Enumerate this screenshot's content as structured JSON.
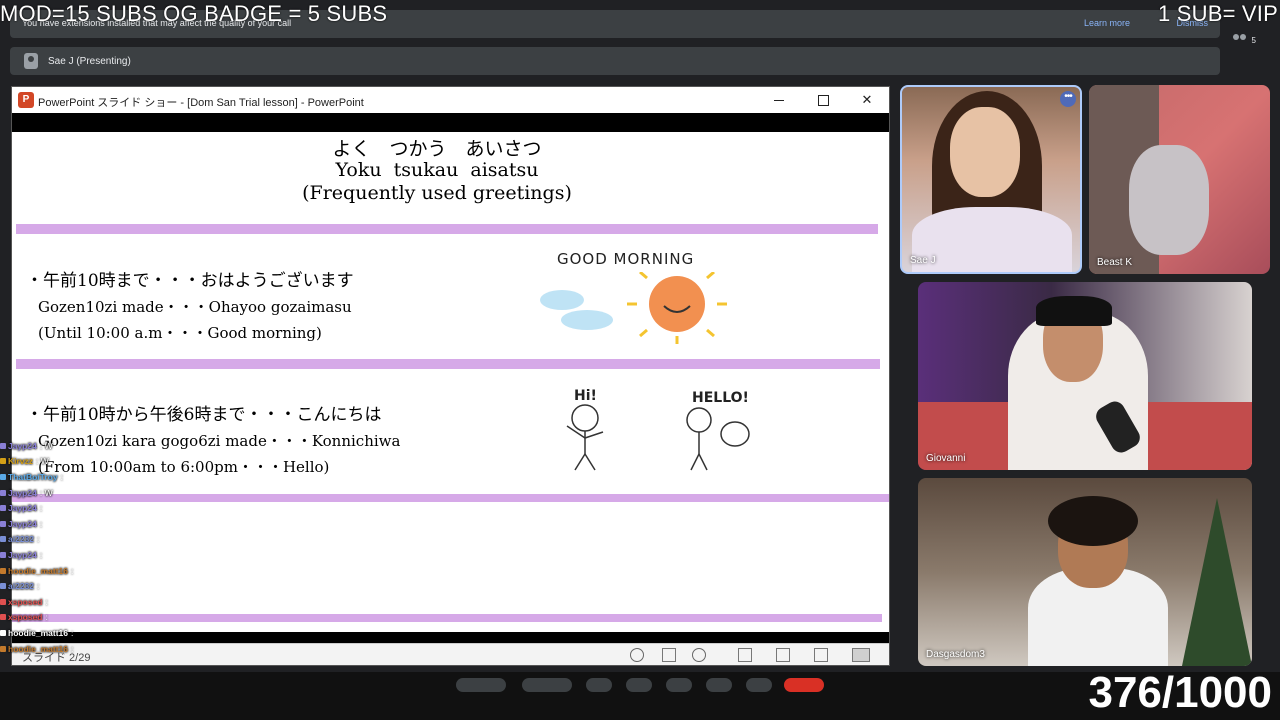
{
  "overlay": {
    "top_left": "MOD=15 SUBS    OG BADGE = 5 SUBS",
    "top_right": "1 SUB= VIP",
    "counter": "376/1000"
  },
  "meet": {
    "warning_banner": {
      "message": "You have extensions installed that may affect the quality of your call",
      "learn_more": "Learn more",
      "dismiss": "Dismiss"
    },
    "presenting_label": "Sae J (Presenting)",
    "participant_count": "5"
  },
  "powerpoint": {
    "window_title": "PowerPoint スライド ショー - [Dom San Trial lesson] - PowerPoint",
    "logo_letter": "P",
    "close_glyph": "✕",
    "slide": {
      "title_jp": "よく　つかう　あいさつ",
      "title_romaji": "Yoku tsukau aisatsu",
      "title_en": "(Frequently used greetings)",
      "item1_jp": "・午前10時まで・・・おはようございます",
      "item1_romaji": "Gozen10zi made・・・Ohayoo gozaimasu",
      "item1_en": "(Until 10:00 a.m・・・Good morning)",
      "item2_jp": "・午前10時から午後6時まで・・・こんにちは",
      "item2_romaji": "Gozen10zi kara gogo6zi made・・・Konnichiwa",
      "item2_en": "(From 10:00am to 6:00pm・・・Hello)",
      "good_morning_label": "GOOD MORNING",
      "hi_label": "Hi!",
      "hello_label": "HELLO!"
    },
    "status": {
      "slide_number": "スライド 2/29"
    }
  },
  "chat": [
    {
      "user": "Jayp24",
      "msg": ": W",
      "color": "#8a7fd6"
    },
    {
      "user": "Kirvzz",
      "msg": ": W",
      "color": "#d4a017"
    },
    {
      "user": "ThatBoiTroy",
      "msg": ":",
      "color": "#5aa9e6"
    },
    {
      "user": "Jayp24",
      "msg": ": W",
      "color": "#8a7fd6"
    },
    {
      "user": "Jayp24",
      "msg": ":",
      "color": "#8a7fd6"
    },
    {
      "user": "Jayp24",
      "msg": ":",
      "color": "#8a7fd6"
    },
    {
      "user": "ai2232",
      "msg": ":",
      "color": "#7a8fd6"
    },
    {
      "user": "Jayp24",
      "msg": ":",
      "color": "#8a7fd6"
    },
    {
      "user": "hoodie_matt16",
      "msg": ":",
      "color": "#c47a2c"
    },
    {
      "user": "ai2232",
      "msg": ":",
      "color": "#7a8fd6"
    },
    {
      "user": "xsposed",
      "msg": ":",
      "color": "#e05050"
    },
    {
      "user": "xsposed",
      "msg": ":",
      "color": "#e05050"
    },
    {
      "user": "hoodie_matt16",
      "msg": ":",
      "color": "#ffffff"
    },
    {
      "user": "hoodie_matt16",
      "msg": ":",
      "color": "#c47a2c"
    }
  ],
  "participants": {
    "sae": "Sae J",
    "beast": "Beast K",
    "giovanni": "Giovanni",
    "dasgasdom": "Dasgasdom3"
  },
  "colors": {
    "slide_accent_bar": "#d6a9e8",
    "meet_banner": "#3c4043",
    "link": "#8ab4f8",
    "active_tile_border": "#aecbfa"
  }
}
